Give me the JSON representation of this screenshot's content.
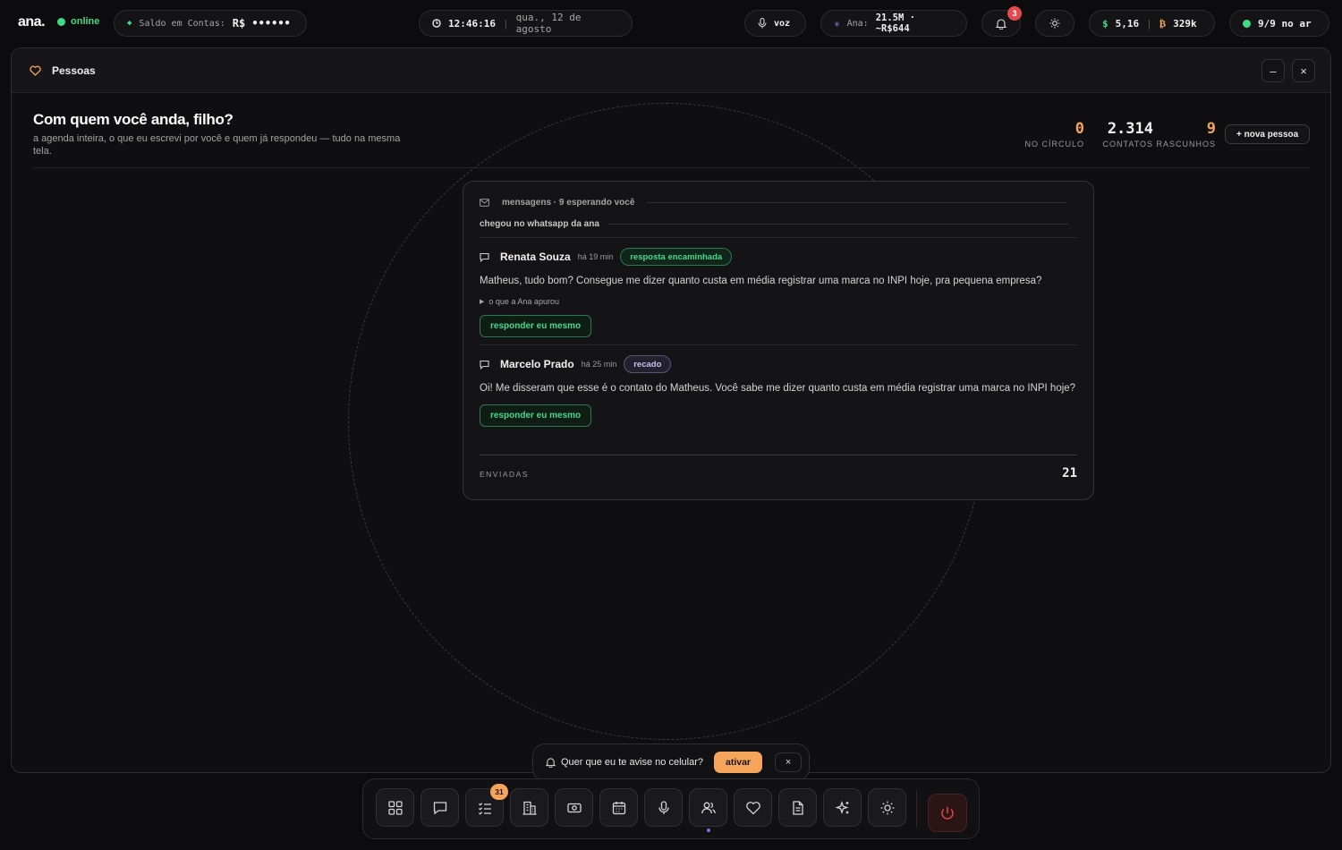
{
  "topbar": {
    "brand": "ana.",
    "status": "online",
    "balance_label": "Saldo em Contas:",
    "balance_value": "R$ ••••••",
    "clock": "12:46:16",
    "date": "qua., 12 de agosto",
    "voice_label": "voz",
    "ana_label": "Ana:",
    "ana_value": "21.5M · ~R$644",
    "notifications_count": "3",
    "dollar_value": "5,16",
    "btc_value": "329k",
    "on_air": "9/9 no ar"
  },
  "window": {
    "title": "Pessoas",
    "minimize": "–",
    "close": "×"
  },
  "page": {
    "heading": "Com quem você anda, filho?",
    "subheading": "a agenda inteira, o que eu escrevi por você e quem já respondeu — tudo na mesma tela.",
    "stats": [
      {
        "value": "0",
        "label": "NO CÍRCULO"
      },
      {
        "value": "2.314",
        "label": "CONTATOS"
      },
      {
        "value": "9",
        "label": "RASCUNHOS"
      }
    ],
    "new_person_button": "+ nova pessoa"
  },
  "messages": {
    "header": "mensagens · 9 esperando você",
    "sublabel": "chegou no whatsapp da ana",
    "items": [
      {
        "name": "Renata Souza",
        "time": "há 19 min",
        "tag": "resposta encaminhada",
        "text": "Matheus, tudo bom? Consegue me dizer quanto custa em média registrar uma marca no INPI hoje, pra pequena empresa?",
        "expand": "o que a Ana apurou",
        "reply": "responder eu mesmo"
      },
      {
        "name": "Marcelo Prado",
        "time": "há 25 min",
        "tag": "recado",
        "text": "Oi! Me disseram que esse é o contato do Matheus. Você sabe me dizer quanto custa em média registrar uma marca no INPI hoje?",
        "reply": "responder eu mesmo"
      }
    ],
    "sent_label": "ENVIADAS",
    "sent_count": "21"
  },
  "toast": {
    "text": "Quer que eu te avise no celular?",
    "action": "ativar",
    "close": "×"
  },
  "dock": {
    "tasks_badge": "31",
    "active": "people"
  },
  "colors": {
    "accent_orange": "#f5a45b",
    "success_green": "#3ddc84",
    "alert_red": "#e5484d",
    "active_purple": "#7f72e8"
  }
}
